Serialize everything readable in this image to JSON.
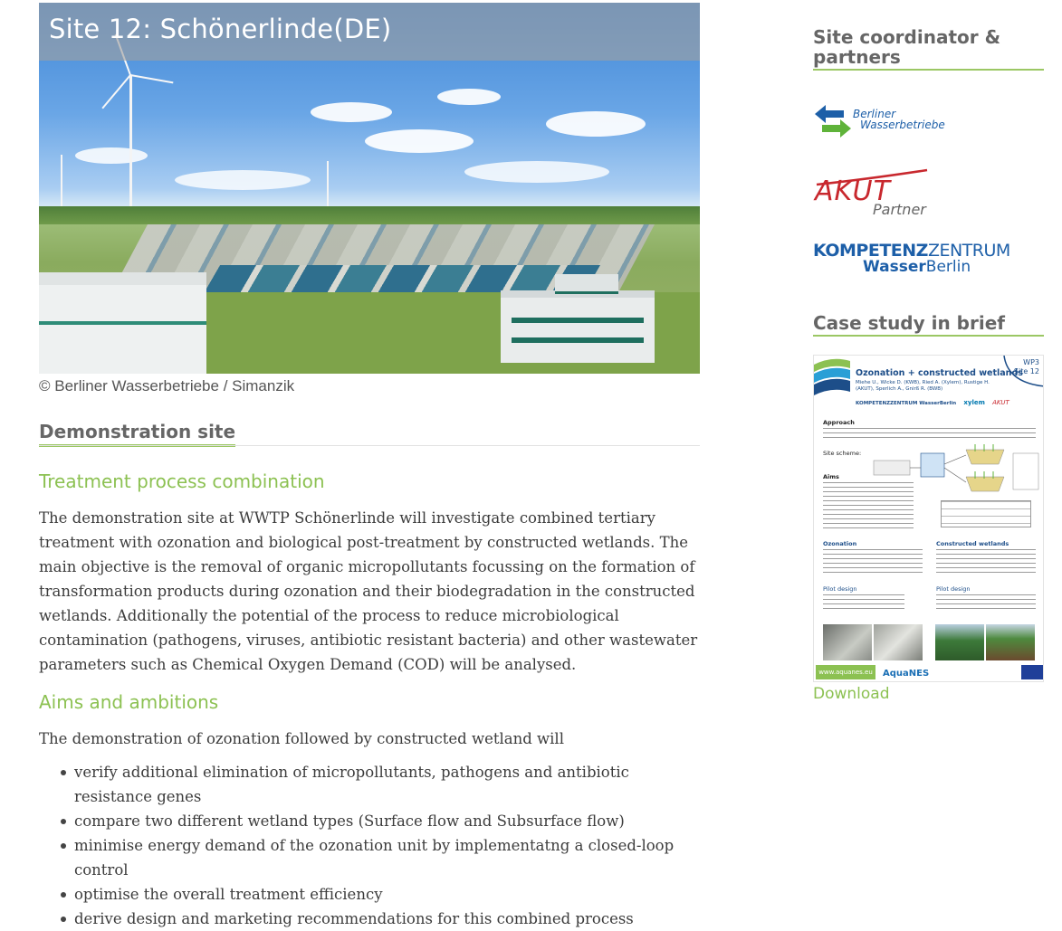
{
  "hero": {
    "title": "Site 12: Schönerlinde(DE)",
    "credit": "© Berliner Wasserbetriebe / Simanzik"
  },
  "main": {
    "section_title": "Demonstration site",
    "treatment": {
      "heading": "Treatment process combination",
      "body": "The demonstration site at WWTP Schönerlinde will investigate combined tertiary treatment with ozonation and biological post-treatment by constructed wetlands. The main objective is the removal of organic micropollutants focussing on the formation of transformation products during ozonation and their biodegradation in the constructed wetlands. Additionally the potential of the process to reduce microbiological contamination (pathogens, viruses, antibiotic resistant bacteria) and other wastewater parameters such as Chemical Oxygen Demand (COD) will be analysed."
    },
    "aims": {
      "heading": "Aims and ambitions",
      "intro": "The demonstration of ozonation followed by constructed wetland will",
      "items": [
        "verify additional elimination of micropollutants, pathogens and antibiotic resistance genes",
        "compare two different wetland types (Surface flow and Subsurface flow)",
        "minimise energy demand of the ozonation unit by implementatng a closed-loop control",
        "optimise the overall treatment efficiency",
        "derive design and marketing recommendations for this combined process"
      ]
    }
  },
  "sidebar": {
    "partners_title": "Site coordinator & partners",
    "logos": {
      "bwb_line1": "Berliner",
      "bwb_line2": "Wasserbetriebe",
      "akut_main": "AKUT",
      "akut_sub": "Partner",
      "kwb_line1a": "KOMPETENZ",
      "kwb_line1b": "ZENTRUM",
      "kwb_line2a": "Wasser",
      "kwb_line2b": "Berlin"
    },
    "case_title": "Case study in brief",
    "poster": {
      "wp": "WP3",
      "site": "Site 12",
      "title": "Ozonation + constructed wetlands",
      "authors": "Miehe U., Wicke D. (KWB), Ried A. (Xylem), Rustige H. (AKUT), Sperlich A., Gnirß R. (BWB)",
      "approach": "Approach",
      "site_scheme": "Site scheme:",
      "aims": "Aims",
      "ozonation": "Ozonation",
      "constructed_wetlands": "Constructed wetlands",
      "pilot_design_1": "Pilot design",
      "pilot_design_2": "Pilot design",
      "web": "www.aquanes.eu",
      "brand": "AquaNES",
      "partner_xylem": "xylem",
      "partner_akut": "AKUT",
      "partner_kwb": "KOMPETENZZENTRUM WasserBerlin"
    },
    "download_label": "Download"
  },
  "colors": {
    "accent_green": "#8cc152",
    "rule_green": "#9bc764",
    "heading_grey": "#666666",
    "poster_blue": "#1d4e89"
  }
}
